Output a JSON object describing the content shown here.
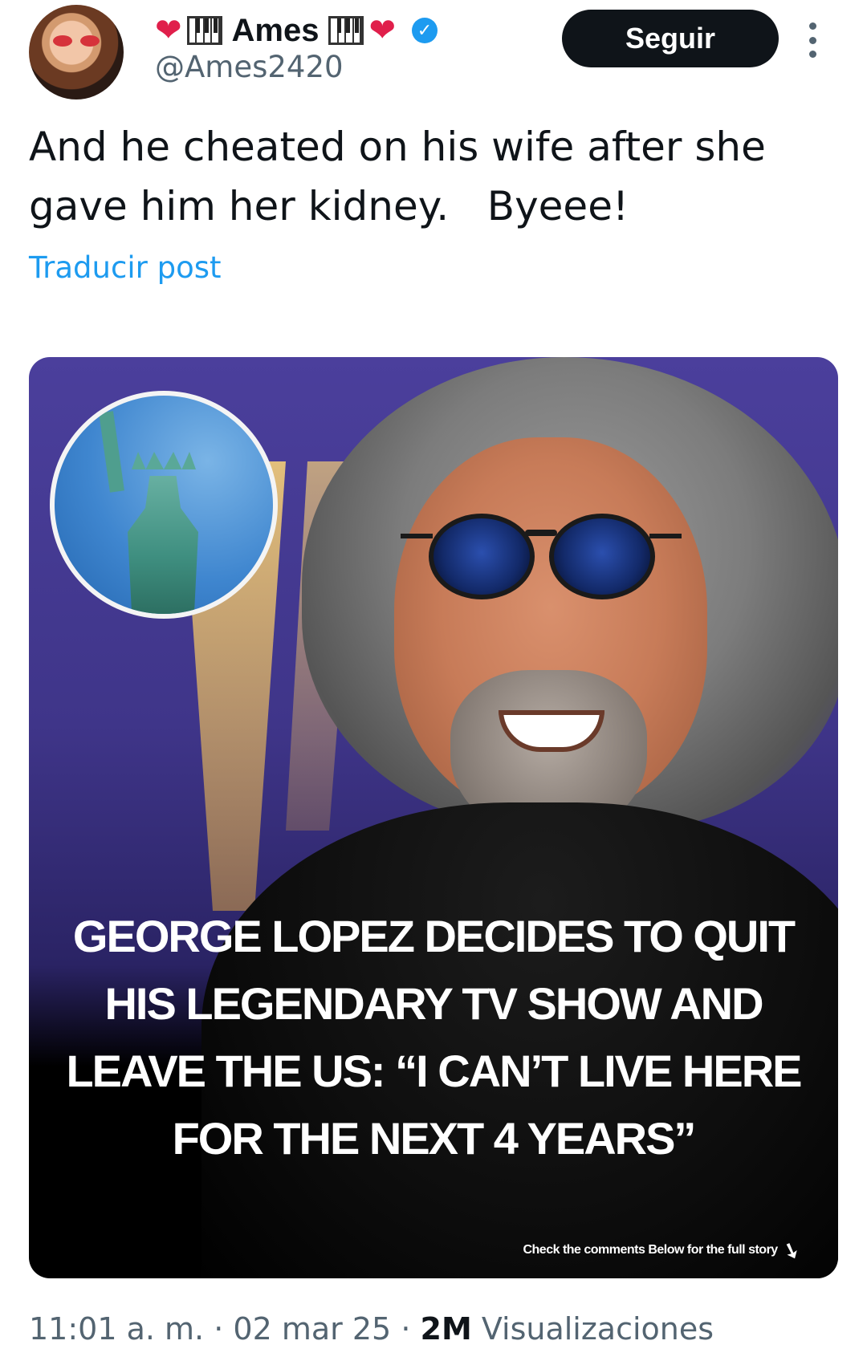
{
  "author": {
    "display_name": "Ames",
    "handle": "@Ames2420",
    "name_decorations": [
      "red-heart-icon",
      "piano-keys-icon"
    ],
    "verified": true
  },
  "follow_button": {
    "label": "Seguir"
  },
  "more_menu": {
    "icon": "more-vertical-icon"
  },
  "tweet": {
    "text": "And he cheated on his wife after she gave him her kidney.   Byeee!",
    "translate_label": "Traducir post"
  },
  "media": {
    "headline": "GEORGE LOPEZ DECIDES TO QUIT HIS LEGENDARY TV SHOW AND LEAVE THE US: “I CAN’T LIVE HERE FOR THE NEXT 4 YEARS”",
    "caption": "Check the comments Below for the full story",
    "caption_icon": "curved-arrow-down-icon",
    "badge_image": "statue-of-liberty"
  },
  "meta": {
    "time": "11:01 a. m.",
    "separator": "·",
    "date": "02 mar 25",
    "views_count": "2M",
    "views_label": "Visualizaciones"
  },
  "colors": {
    "accent": "#1d9bf0",
    "text_primary": "#0f1419",
    "text_secondary": "#536471",
    "button_bg": "#0f1419",
    "heart": "#e01f4b"
  }
}
